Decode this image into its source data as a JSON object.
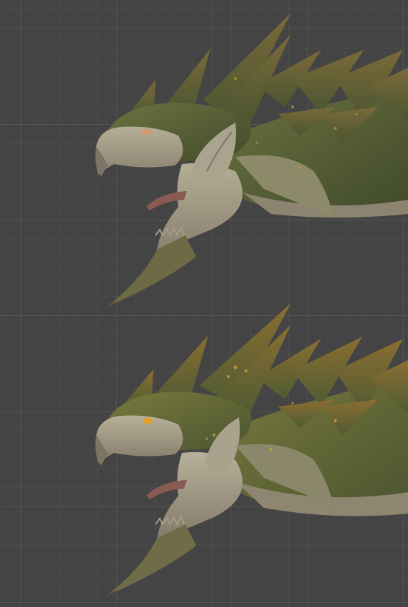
{
  "viewport": {
    "background": "#444444",
    "grid_major": "#545454",
    "grid_minor": "#4b4b4b"
  },
  "renders": [
    {
      "id": "render-top",
      "variant": "mossy-green",
      "eye_color": "#d59a6b"
    },
    {
      "id": "render-bottom",
      "variant": "olive-ochre",
      "eye_color": "#e0a12a"
    }
  ],
  "palette": {
    "moss": "#5f6b3a",
    "moss_dark": "#3c4328",
    "ochre": "#8a7a3a",
    "bone": "#b7b09a",
    "bone_dark": "#7d7565",
    "horn_tip": "#6b4a34",
    "tongue": "#8a5a52",
    "wing": "#2f2c2b"
  }
}
